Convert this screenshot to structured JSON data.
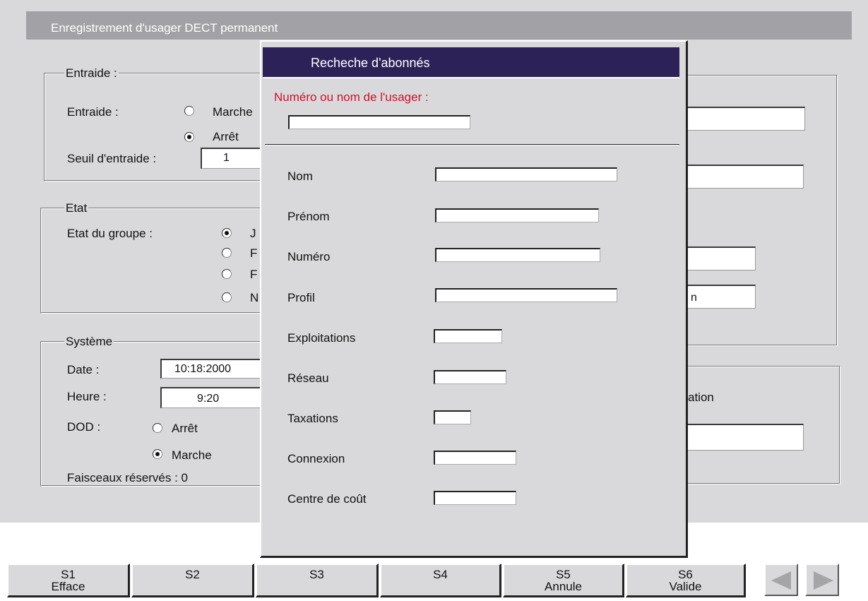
{
  "window": {
    "title": "Enregistrement d'usager DECT permanent"
  },
  "entraide": {
    "legend": "Entraide :",
    "label": "Entraide :",
    "opt_on": "Marche",
    "opt_off": "Arrêt",
    "seuil_label": "Seuil d'entraide :",
    "seuil_value": "1"
  },
  "etat": {
    "legend": "Etat",
    "label": "Etat du groupe :",
    "opt1": "J",
    "opt2": "F",
    "opt3": "F",
    "opt4": "N"
  },
  "systeme": {
    "legend": "Système",
    "date_label": "Date :",
    "date_value": "10:18:2000",
    "heure_label": "Heure :",
    "heure_value": "9:20",
    "dod_label": "DOD :",
    "dod_off": "Arrêt",
    "dod_on": "Marche",
    "faisceaux": "Faisceaux réservés : 0"
  },
  "right_panel": {
    "field4_value": "n",
    "label_ation": "ation"
  },
  "dialog": {
    "title": "Recheche d'abonnés",
    "search_label": "Numéro ou nom de l'usager :",
    "search_value": "",
    "fields": {
      "nom": "Nom",
      "prenom": "Prénom",
      "numero": "Numéro",
      "profil": "Profil",
      "exploitations": "Exploitations",
      "reseau": "Réseau",
      "taxations": "Taxations",
      "connexion": "Connexion",
      "centre": "Centre de coût"
    }
  },
  "fkeys": {
    "s1": "S1",
    "s1_sub": "Efface",
    "s2": "S2",
    "s3": "S3",
    "s4": "S4",
    "s5": "S5",
    "s5_sub": "Annule",
    "s6": "S6",
    "s6_sub": "Valide"
  },
  "colors": {
    "dialog_title_bg": "#2d2257",
    "label_red": "#d0102a",
    "panel_bg": "#d9d9dc"
  },
  "icons": {
    "nav_left": "triangle-left-icon",
    "nav_right": "triangle-right-icon"
  }
}
